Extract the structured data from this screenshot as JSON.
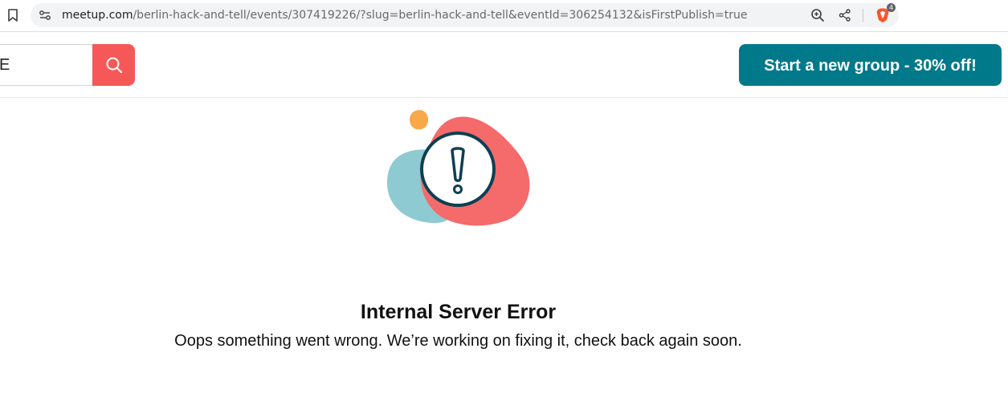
{
  "browser": {
    "url_host": "meetup.com",
    "url_path": "/berlin-hack-and-tell/events/307419226/?slug=berlin-hack-and-tell&eventId=306254132&isFirstPublish=true",
    "shield_badge_count": "4",
    "icons": [
      "bookmark-icon",
      "site-settings-icon",
      "zoom-icon",
      "share-icon",
      "brave-shield-icon"
    ]
  },
  "header": {
    "search_value": "E",
    "search_icon": "search-icon",
    "cta_label": "Start a new group - 30% off!"
  },
  "error": {
    "title": "Internal Server Error",
    "message": "Oops something went wrong. We’re working on fixing it, check back again soon."
  },
  "colors": {
    "search_button": "#f65858",
    "cta_button": "#00798a",
    "blob_coral": "#f56a6a",
    "blob_teal": "#8ecad1",
    "blob_orange": "#f9a84a",
    "alert_ring": "#0c4052"
  }
}
